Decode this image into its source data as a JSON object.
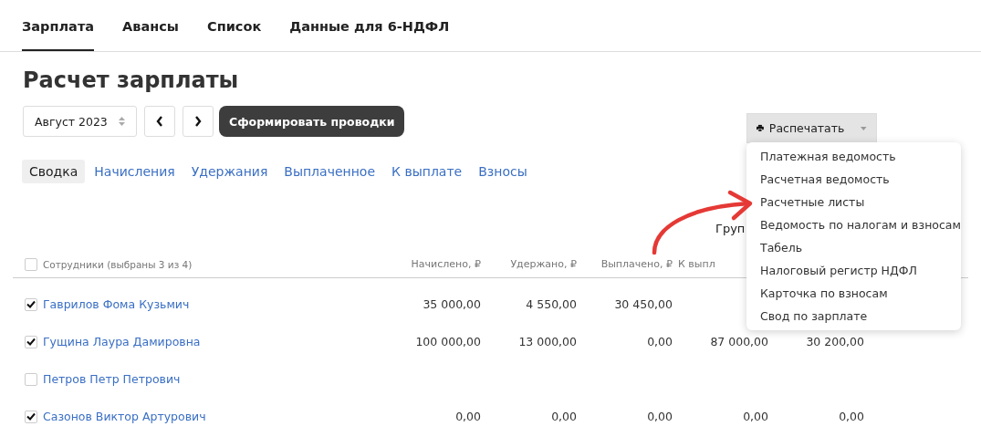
{
  "top_tabs": [
    {
      "label": "Зарплата",
      "selected": true
    },
    {
      "label": "Авансы",
      "selected": false
    },
    {
      "label": "Список",
      "selected": false
    },
    {
      "label": "Данные для 6-НДФЛ",
      "selected": false
    }
  ],
  "title": "Расчет зарплаты",
  "period": {
    "value": "Август 2023"
  },
  "post_button": "Сформировать проводки",
  "print_button": {
    "label": "Распечатать",
    "expanded": true
  },
  "print_menu": [
    "Платежная ведомость",
    "Расчетная ведомость",
    "Расчетные листы",
    "Ведомость по налогам и взносам",
    "Табель",
    "Налоговый регистр НДФЛ",
    "Карточка по взносам",
    "Свод по зарплате"
  ],
  "sub_tabs": [
    {
      "label": "Сводка",
      "selected": true
    },
    {
      "label": "Начисления",
      "selected": false
    },
    {
      "label": "Удержания",
      "selected": false
    },
    {
      "label": "Выплаченное",
      "selected": false
    },
    {
      "label": "К выплате",
      "selected": false
    },
    {
      "label": "Взносы",
      "selected": false
    }
  ],
  "group_label": "Груп",
  "table": {
    "select_all": {
      "label": "Сотрудники (выбраны 3 из 4)",
      "checked": false
    },
    "columns": [
      "Начислено, ₽",
      "Удержано, ₽",
      "Выплачено, ₽",
      "К выпл"
    ],
    "rows": [
      {
        "name": "Гаврилов Фома Кузьмич",
        "checked": true,
        "cells": [
          "35 000,00",
          "4 550,00",
          "30 450,00",
          null,
          null
        ]
      },
      {
        "name": "Гущина Лаура Дамировна",
        "checked": true,
        "cells": [
          "100 000,00",
          "13 000,00",
          "0,00",
          "87 000,00",
          "30 200,00"
        ]
      },
      {
        "name": "Петров Петр Петрович",
        "checked": false,
        "cells": [
          null,
          null,
          null,
          null,
          null
        ]
      },
      {
        "name": "Сазонов Виктор Артурович",
        "checked": true,
        "cells": [
          "0,00",
          "0,00",
          "0,00",
          "0,00",
          "0,00"
        ]
      }
    ]
  }
}
